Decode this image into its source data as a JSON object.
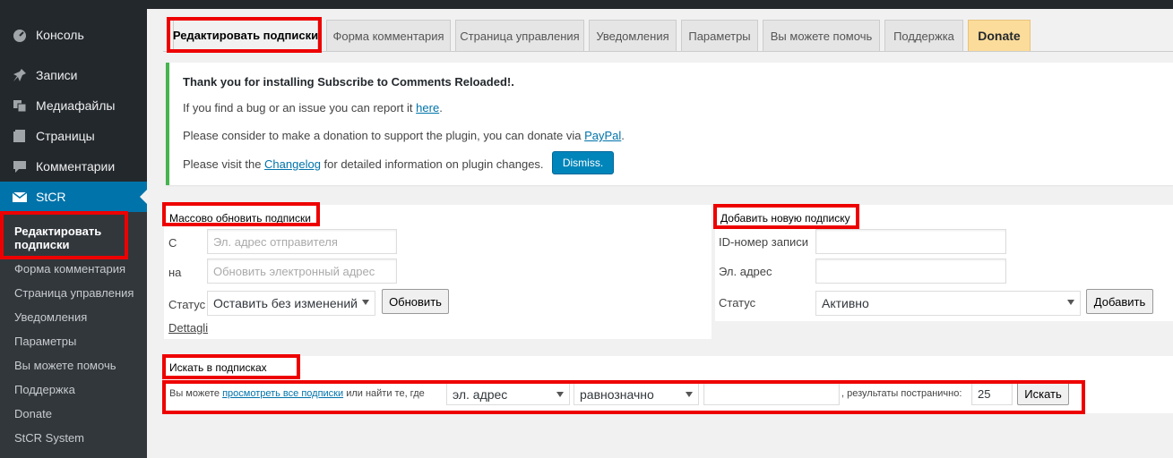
{
  "sidebar": {
    "items": [
      {
        "label": "Консоль",
        "icon": "dashboard-icon"
      },
      {
        "label": "Записи",
        "icon": "pin-icon"
      },
      {
        "label": "Медиафайлы",
        "icon": "media-icon"
      },
      {
        "label": "Страницы",
        "icon": "pages-icon"
      },
      {
        "label": "Комментарии",
        "icon": "comment-icon"
      },
      {
        "label": "StCR",
        "icon": "mail-icon"
      }
    ],
    "submenu": [
      "Редактировать подписки",
      "Форма комментария",
      "Страница управления",
      "Уведомления",
      "Параметры",
      "Вы можете помочь",
      "Поддержка",
      "Donate",
      "StCR System"
    ]
  },
  "tabs": [
    "Редактировать подписки",
    "Форма комментария",
    "Страница управления",
    "Уведомления",
    "Параметры",
    "Вы можете помочь",
    "Поддержка",
    "Donate"
  ],
  "notice": {
    "title": "Thank you for installing Subscribe to Comments Reloaded!.",
    "line1_pre": "If you find a bug or an issue you can report it ",
    "line1_link": "here",
    "line1_post": ".",
    "line2_pre": "Please consider to make a donation to support the plugin, you can donate via ",
    "line2_link": "PayPal",
    "line2_post": ".",
    "line3_pre": "Please visit the ",
    "line3_link": "Changelog",
    "line3_post": " for detailed information on plugin changes.",
    "dismiss": "Dismiss."
  },
  "mass_update": {
    "title": "Массово обновить подписки",
    "from_label": "С",
    "from_placeholder": "Эл. адрес отправителя",
    "to_label": "на",
    "to_placeholder": "Обновить электронный адрес",
    "status_label": "Статус",
    "status_value": "Оставить без изменений",
    "button": "Обновить",
    "details_link": "Dettagli"
  },
  "add_new": {
    "title": "Добавить новую подписку",
    "post_id_label": "ID-номер записи",
    "email_label": "Эл. адрес",
    "status_label": "Статус",
    "status_value": "Активно",
    "button": "Добавить"
  },
  "search": {
    "title": "Искать в подписках",
    "text_pre": "Вы можете ",
    "link": "просмотреть все подписки",
    "text_mid": " или найти те, где",
    "field_value": "эл. адрес",
    "operator_value": "равнозначно",
    "results_label": ", результаты постранично:",
    "per_page": "25",
    "button": "Искать"
  },
  "colors": {
    "sidebar_bg": "#23282d",
    "accent": "#0073aa",
    "notice_border": "#46b450",
    "highlight": "#ee0000",
    "donate_bg": "#fcdc9a"
  }
}
